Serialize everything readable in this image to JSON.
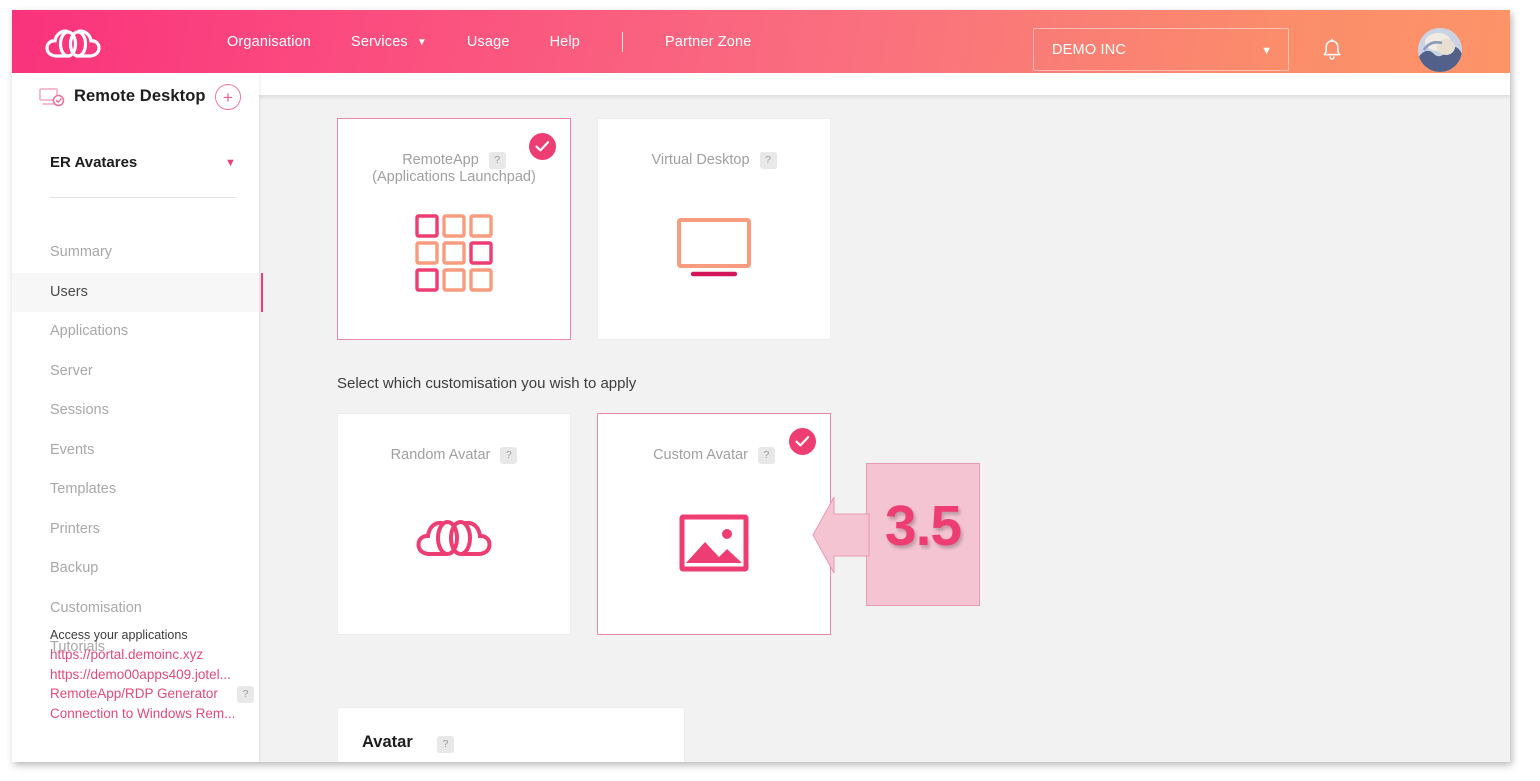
{
  "header": {
    "logo_icon": "cloud-logo-icon",
    "nav": [
      {
        "label": "Organisation",
        "caret": false
      },
      {
        "label": "Services",
        "caret": true,
        "caret_glyph": "▼"
      },
      {
        "label": "Usage",
        "caret": false
      },
      {
        "label": "Help",
        "caret": false
      },
      {
        "label": "Partner Zone",
        "caret": false
      }
    ],
    "org_selector": {
      "value": "DEMO INC",
      "caret_glyph": "▼"
    },
    "bell_icon": "notification-bell-icon",
    "user_avatar_icon": "user-avatar-photo"
  },
  "sidebar": {
    "product": {
      "title": "Remote Desktop",
      "icon": "remote-desktop-icon",
      "add_label": "+"
    },
    "group": {
      "label": "ER Avatares",
      "caret_glyph": "▼"
    },
    "items": [
      {
        "label": "Summary",
        "active": false
      },
      {
        "label": "Users",
        "active": true
      },
      {
        "label": "Applications",
        "active": false
      },
      {
        "label": "Server",
        "active": false
      },
      {
        "label": "Sessions",
        "active": false
      },
      {
        "label": "Events",
        "active": false
      },
      {
        "label": "Templates",
        "active": false
      },
      {
        "label": "Printers",
        "active": false
      },
      {
        "label": "Backup",
        "active": false
      },
      {
        "label": "Customisation",
        "active": false
      },
      {
        "label": "Tutorials",
        "active": false
      }
    ],
    "links": {
      "caption": "Access your applications",
      "items": [
        {
          "label": "https://portal.demoinc.xyz",
          "help": false
        },
        {
          "label": "https://demo00apps409.jotel...",
          "help": false
        },
        {
          "label": "RemoteApp/RDP Generator",
          "help": true,
          "help_glyph": "?"
        },
        {
          "label": "Connection to Windows Rem...",
          "help": false
        }
      ]
    }
  },
  "main": {
    "mode_cards": [
      {
        "title_line1": "RemoteApp",
        "title_line2": "(Applications Launchpad)",
        "help_glyph": "?",
        "selected": true,
        "icon": "applications-grid-icon"
      },
      {
        "title_line1": "Virtual Desktop",
        "title_line2": "",
        "help_glyph": "?",
        "selected": false,
        "icon": "monitor-icon"
      }
    ],
    "section_label": "Select which customisation you wish to apply",
    "avatar_cards": [
      {
        "title_line1": "Random Avatar",
        "title_line2": "",
        "help_glyph": "?",
        "selected": false,
        "icon": "cloud-logo-icon"
      },
      {
        "title_line1": "Custom Avatar",
        "title_line2": "",
        "help_glyph": "?",
        "selected": true,
        "icon": "image-picture-icon"
      }
    ],
    "annotation": {
      "number": "3.5",
      "arrow_icon": "left-arrow-callout-icon"
    },
    "avatar_panel": {
      "title": "Avatar",
      "help_glyph": "?"
    }
  },
  "colors": {
    "brand_pink": "#ee3d72",
    "brand_orange": "#f79c7e",
    "header_gradient_start": "#f9327c",
    "header_gradient_end": "#fc9468",
    "content_bg": "#f2f2f2",
    "callout_fill": "#f4c4d2"
  }
}
